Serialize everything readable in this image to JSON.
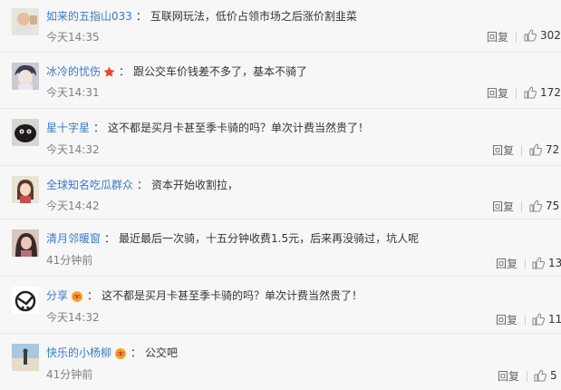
{
  "reply_label": "回复",
  "comments": [
    {
      "user": "如来的五指山033",
      "separator": "：",
      "text": "互联网玩法，低价占领市场之后涨价割韭菜",
      "time": "今天14:35",
      "likes": "302",
      "badge": "",
      "avatar_icon": "avatar-child-photo"
    },
    {
      "user": "冰冷的忧伤",
      "separator": "：",
      "text": "跟公交车价钱差不多了，基本不骑了",
      "time": "今天14:31",
      "likes": "172",
      "badge": "star-badge-icon",
      "avatar_icon": "avatar-anime-boy"
    },
    {
      "user": "星十字星",
      "separator": "：",
      "text": "这不都是买月卡甚至季卡骑的吗？单次计费当然贵了！",
      "time": "今天14:32",
      "likes": "72",
      "badge": "",
      "avatar_icon": "avatar-dark-creature"
    },
    {
      "user": "全球知名吃瓜群众",
      "separator": "：",
      "text": "资本开始收割拉，",
      "time": "今天14:42",
      "likes": "75",
      "badge": "",
      "avatar_icon": "avatar-girl-drawing"
    },
    {
      "user": "清月邻暖窗",
      "separator": "：",
      "text": "最近最后一次骑，十五分钟收费1.5元，后来再没骑过，坑人呢",
      "time": "41分钟前",
      "likes": "13",
      "badge": "",
      "avatar_icon": "avatar-woman-photo"
    },
    {
      "user": "分享",
      "separator": "：",
      "text": "这不都是买月卡甚至季卡骑的吗？单次计费当然贵了！",
      "time": "今天14:32",
      "likes": "11",
      "badge": "crown-badge-icon",
      "avatar_icon": "avatar-logo-circle"
    },
    {
      "user": "快乐的小杨柳",
      "separator": "：",
      "text": "公交吧",
      "time": "41分钟前",
      "likes": "5",
      "badge": "crown-badge-icon",
      "avatar_icon": "avatar-beach-photo"
    }
  ],
  "colors": {
    "username": "#3a7ac8",
    "text": "#333333",
    "muted": "#808080",
    "background": "#f7f7f7",
    "divider": "#e6e6e6",
    "star_badge": "#e8452c",
    "crown_badge": "#f5a623"
  }
}
